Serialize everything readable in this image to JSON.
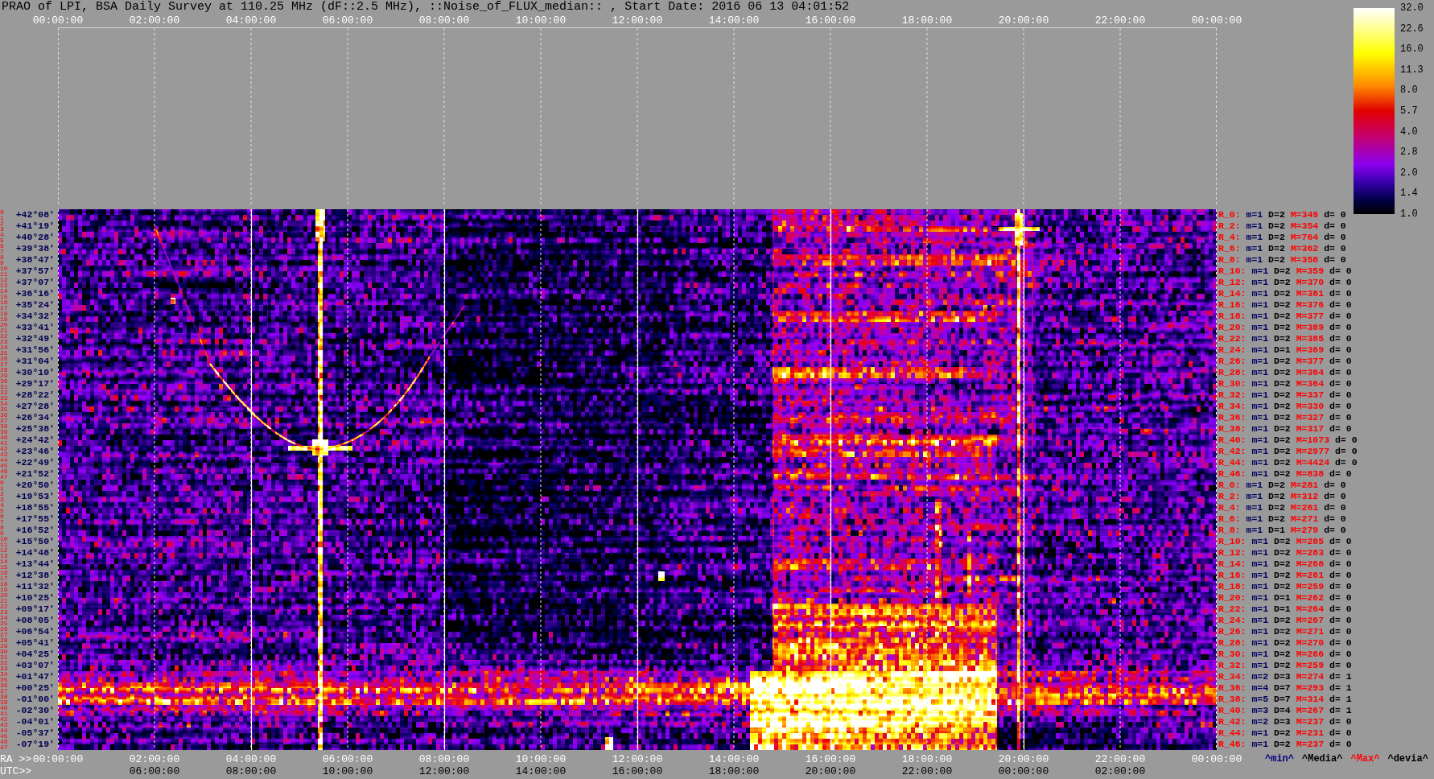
{
  "title": "PRAO of LPI, BSA Daily Survey at 110.25 MHz (dF::2.5 MHz), ::Noise_of_FLUX_median:: , Start Date: 2016 06 13 04:01:52",
  "top_axis": {
    "ticks": [
      "00:00:00",
      "02:00:00",
      "04:00:00",
      "06:00:00",
      "08:00:00",
      "10:00:00",
      "12:00:00",
      "14:00:00",
      "16:00:00",
      "18:00:00",
      "20:00:00",
      "22:00:00",
      "00:00:00"
    ]
  },
  "colorbar": {
    "labels": [
      "32.0",
      "22.6",
      "16.0",
      "11.3",
      "8.0",
      "5.7",
      "4.0",
      "2.8",
      "2.0",
      "1.4",
      "1.0"
    ]
  },
  "beam_groups": [
    {
      "row_numbers": [
        "0",
        "1",
        "2",
        "3",
        "4",
        "5",
        "6",
        "7",
        "8",
        "9",
        "10",
        "11",
        "12",
        "13",
        "14",
        "15",
        "16",
        "17",
        "18",
        "19",
        "20",
        "21",
        "22",
        "23",
        "24",
        "25",
        "26",
        "27",
        "28",
        "29",
        "30",
        "31",
        "32",
        "33",
        "34",
        "35",
        "36",
        "37",
        "38",
        "39",
        "40",
        "41",
        "42",
        "43",
        "44",
        "45",
        "46",
        "47"
      ],
      "rows": [
        {
          "declination": "+42°08′",
          "beam": "R_0:",
          "min": "m=1",
          "median": "D=2",
          "max": "M=349",
          "deviation": "d= 0"
        },
        {
          "declination": "+41°19′",
          "beam": "R_2:",
          "min": "m=1",
          "median": "D=2",
          "max": "M=354",
          "deviation": "d= 0"
        },
        {
          "declination": "+40°28′",
          "beam": "R_4:",
          "min": "m=1",
          "median": "D=2",
          "max": "M=764",
          "deviation": "d= 0"
        },
        {
          "declination": "+39°38′",
          "beam": "R_6:",
          "min": "m=1",
          "median": "D=2",
          "max": "M=362",
          "deviation": "d= 0"
        },
        {
          "declination": "+38°47′",
          "beam": "R_8:",
          "min": "m=1",
          "median": "D=2",
          "max": "M=358",
          "deviation": "d= 0"
        },
        {
          "declination": "+37°57′",
          "beam": "R_10:",
          "min": "m=1",
          "median": "D=2",
          "max": "M=359",
          "deviation": "d= 0"
        },
        {
          "declination": "+37°07′",
          "beam": "R_12:",
          "min": "m=1",
          "median": "D=2",
          "max": "M=370",
          "deviation": "d= 0"
        },
        {
          "declination": "+36°16′",
          "beam": "R_14:",
          "min": "m=1",
          "median": "D=2",
          "max": "M=381",
          "deviation": "d= 0"
        },
        {
          "declination": "+35°24′",
          "beam": "R_16:",
          "min": "m=1",
          "median": "D=2",
          "max": "M=376",
          "deviation": "d= 0"
        },
        {
          "declination": "+34°32′",
          "beam": "R_18:",
          "min": "m=1",
          "median": "D=2",
          "max": "M=377",
          "deviation": "d= 0"
        },
        {
          "declination": "+33°41′",
          "beam": "R_20:",
          "min": "m=1",
          "median": "D=2",
          "max": "M=389",
          "deviation": "d= 0"
        },
        {
          "declination": "+32°49′",
          "beam": "R_22:",
          "min": "m=1",
          "median": "D=2",
          "max": "M=385",
          "deviation": "d= 0"
        },
        {
          "declination": "+31°56′",
          "beam": "R_24:",
          "min": "m=1",
          "median": "D=1",
          "max": "M=369",
          "deviation": "d= 0"
        },
        {
          "declination": "+31°04′",
          "beam": "R_26:",
          "min": "m=1",
          "median": "D=2",
          "max": "M=377",
          "deviation": "d= 0"
        },
        {
          "declination": "+30°10′",
          "beam": "R_28:",
          "min": "m=1",
          "median": "D=2",
          "max": "M=364",
          "deviation": "d= 0"
        },
        {
          "declination": "+29°17′",
          "beam": "R_30:",
          "min": "m=1",
          "median": "D=2",
          "max": "M=364",
          "deviation": "d= 0"
        },
        {
          "declination": "+28°22′",
          "beam": "R_32:",
          "min": "m=1",
          "median": "D=2",
          "max": "M=337",
          "deviation": "d= 0"
        },
        {
          "declination": "+27°28′",
          "beam": "R_34:",
          "min": "m=1",
          "median": "D=2",
          "max": "M=330",
          "deviation": "d= 0"
        },
        {
          "declination": "+26°34′",
          "beam": "R_36:",
          "min": "m=1",
          "median": "D=2",
          "max": "M=327",
          "deviation": "d= 0"
        },
        {
          "declination": "+25°38′",
          "beam": "R_38:",
          "min": "m=1",
          "median": "D=2",
          "max": "M=317",
          "deviation": "d= 0"
        },
        {
          "declination": "+24°42′",
          "beam": "R_40:",
          "min": "m=1",
          "median": "D=2",
          "max": "M=1073",
          "deviation": "d= 0"
        },
        {
          "declination": "+23°46′",
          "beam": "R_42:",
          "min": "m=1",
          "median": "D=2",
          "max": "M=2977",
          "deviation": "d= 0"
        },
        {
          "declination": "+22°49′",
          "beam": "R_44:",
          "min": "m=1",
          "median": "D=2",
          "max": "M=4424",
          "deviation": "d= 0"
        },
        {
          "declination": "+21°52′",
          "beam": "R_46:",
          "min": "m=1",
          "median": "D=2",
          "max": "M=838",
          "deviation": "d= 0"
        }
      ]
    },
    {
      "row_numbers": [
        "0",
        "1",
        "2",
        "3",
        "4",
        "5",
        "6",
        "7",
        "8",
        "9",
        "10",
        "11",
        "12",
        "13",
        "14",
        "15",
        "16",
        "17",
        "18",
        "19",
        "20",
        "21",
        "22",
        "23",
        "24",
        "25",
        "26",
        "27",
        "28",
        "29",
        "30",
        "31",
        "32",
        "33",
        "34",
        "35",
        "36",
        "37",
        "38",
        "39",
        "40",
        "41",
        "42",
        "43",
        "44",
        "45",
        "46",
        "47"
      ],
      "rows": [
        {
          "declination": "+20°50′",
          "beam": "R_0:",
          "min": "m=1",
          "median": "D=2",
          "max": "M=281",
          "deviation": "d= 0"
        },
        {
          "declination": "+19°53′",
          "beam": "R_2:",
          "min": "m=1",
          "median": "D=2",
          "max": "M=312",
          "deviation": "d= 0"
        },
        {
          "declination": "+18°55′",
          "beam": "R_4:",
          "min": "m=1",
          "median": "D=2",
          "max": "M=261",
          "deviation": "d= 0"
        },
        {
          "declination": "+17°55′",
          "beam": "R_6:",
          "min": "m=1",
          "median": "D=2",
          "max": "M=271",
          "deviation": "d= 0"
        },
        {
          "declination": "+16°52′",
          "beam": "R_8:",
          "min": "m=1",
          "median": "D=1",
          "max": "M=279",
          "deviation": "d= 0"
        },
        {
          "declination": "+15°50′",
          "beam": "R_10:",
          "min": "m=1",
          "median": "D=2",
          "max": "M=285",
          "deviation": "d= 0"
        },
        {
          "declination": "+14°48′",
          "beam": "R_12:",
          "min": "m=1",
          "median": "D=2",
          "max": "M=283",
          "deviation": "d= 0"
        },
        {
          "declination": "+13°44′",
          "beam": "R_14:",
          "min": "m=1",
          "median": "D=2",
          "max": "M=268",
          "deviation": "d= 0"
        },
        {
          "declination": "+12°38′",
          "beam": "R_16:",
          "min": "m=1",
          "median": "D=2",
          "max": "M=261",
          "deviation": "d= 0"
        },
        {
          "declination": "+11°32′",
          "beam": "R_18:",
          "min": "m=1",
          "median": "D=2",
          "max": "M=259",
          "deviation": "d= 0"
        },
        {
          "declination": "+10°25′",
          "beam": "R_20:",
          "min": "m=1",
          "median": "D=1",
          "max": "M=262",
          "deviation": "d= 0"
        },
        {
          "declination": "+09°17′",
          "beam": "R_22:",
          "min": "m=1",
          "median": "D=1",
          "max": "M=264",
          "deviation": "d= 0"
        },
        {
          "declination": "+08°05′",
          "beam": "R_24:",
          "min": "m=1",
          "median": "D=2",
          "max": "M=267",
          "deviation": "d= 0"
        },
        {
          "declination": "+06°54′",
          "beam": "R_26:",
          "min": "m=1",
          "median": "D=2",
          "max": "M=271",
          "deviation": "d= 0"
        },
        {
          "declination": "+05°41′",
          "beam": "R_28:",
          "min": "m=1",
          "median": "D=2",
          "max": "M=270",
          "deviation": "d= 0"
        },
        {
          "declination": "+04°25′",
          "beam": "R_30:",
          "min": "m=1",
          "median": "D=2",
          "max": "M=266",
          "deviation": "d= 0"
        },
        {
          "declination": "+03°07′",
          "beam": "R_32:",
          "min": "m=1",
          "median": "D=2",
          "max": "M=259",
          "deviation": "d= 0"
        },
        {
          "declination": "+01°47′",
          "beam": "R_34:",
          "min": "m=2",
          "median": "D=3",
          "max": "M=274",
          "deviation": "d= 1"
        },
        {
          "declination": "+00°25′",
          "beam": "R_36:",
          "min": "m=4",
          "median": "D=7",
          "max": "M=293",
          "deviation": "d= 1"
        },
        {
          "declination": "-01°00′",
          "beam": "R_38:",
          "min": "m=5",
          "median": "D=7",
          "max": "M=314",
          "deviation": "d= 1"
        },
        {
          "declination": "-02°30′",
          "beam": "R_40:",
          "min": "m=3",
          "median": "D=4",
          "max": "M=267",
          "deviation": "d= 1"
        },
        {
          "declination": "-04°01′",
          "beam": "R_42:",
          "min": "m=2",
          "median": "D=3",
          "max": "M=237",
          "deviation": "d= 0"
        },
        {
          "declination": "-05°37′",
          "beam": "R_44:",
          "min": "m=1",
          "median": "D=2",
          "max": "M=231",
          "deviation": "d= 0"
        },
        {
          "declination": "-07°19′",
          "beam": "R_46:",
          "min": "m=1",
          "median": "D=2",
          "max": "M=237",
          "deviation": "d= 0"
        }
      ]
    }
  ],
  "bottom_axis": {
    "ra_prefix": "RA >>",
    "ra_ticks": [
      "00:00:00",
      "02:00:00",
      "04:00:00",
      "06:00:00",
      "08:00:00",
      "10:00:00",
      "12:00:00",
      "14:00:00",
      "16:00:00",
      "18:00:00",
      "20:00:00",
      "22:00:00",
      "00:00:00"
    ],
    "utc_prefix": "UTC>>",
    "utc_ticks": [
      "06:00:00",
      "08:00:00",
      "10:00:00",
      "12:00:00",
      "14:00:00",
      "16:00:00",
      "18:00:00",
      "20:00:00",
      "22:00:00",
      "00:00:00",
      "02:00:00"
    ],
    "legend": [
      {
        "text": "^min^",
        "color": "#000080"
      },
      {
        "text": "^Media^",
        "color": "#000000"
      },
      {
        "text": "^Max^",
        "color": "#ff0000"
      },
      {
        "text": "^devia^",
        "color": "#000000"
      }
    ]
  }
}
